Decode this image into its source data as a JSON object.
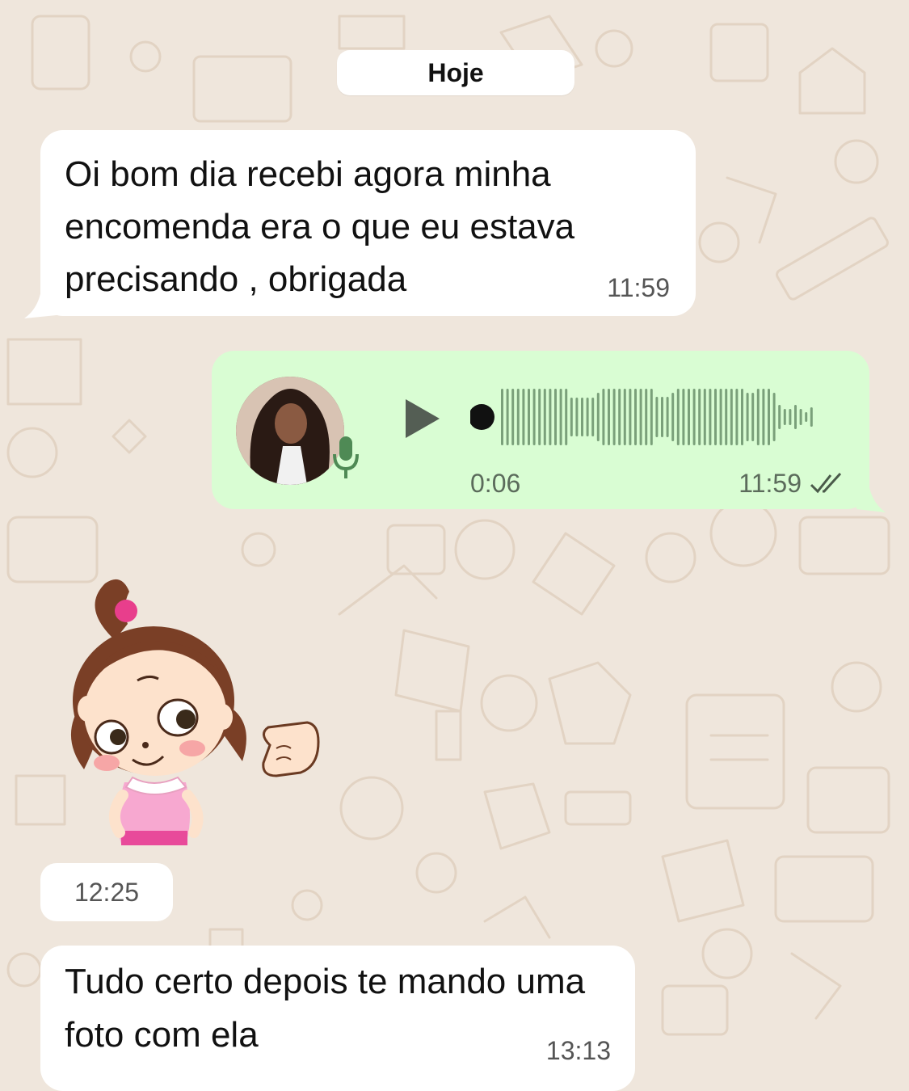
{
  "chat": {
    "date_label": "Hoje",
    "messages": [
      {
        "direction": "incoming",
        "type": "text",
        "text": "Oi bom dia  recebi agora minha encomenda era o que eu estava precisando , obrigada",
        "time": "11:59"
      },
      {
        "direction": "outgoing",
        "type": "voice",
        "duration": "0:06",
        "time": "11:59",
        "status_icon": "double-check-icon",
        "playback_progress": 0.0
      },
      {
        "direction": "incoming",
        "type": "sticker",
        "sticker_name": "girl-fist-bump-sticker",
        "time": "12:25"
      },
      {
        "direction": "incoming",
        "type": "text",
        "text": "Tudo certo depois te mando uma foto com ela",
        "time": "13:13"
      }
    ]
  },
  "colors": {
    "wallpaper": "#efe6dc",
    "wallpaper_doodle": "#e2d3c3",
    "incoming_bubble": "#ffffff",
    "outgoing_bubble": "#d9fdd3",
    "waveform": "#7aa07a",
    "time_text": "#555555"
  },
  "icons": {
    "play": "play-icon",
    "mic": "mic-icon",
    "read_receipt": "double-check-icon"
  }
}
